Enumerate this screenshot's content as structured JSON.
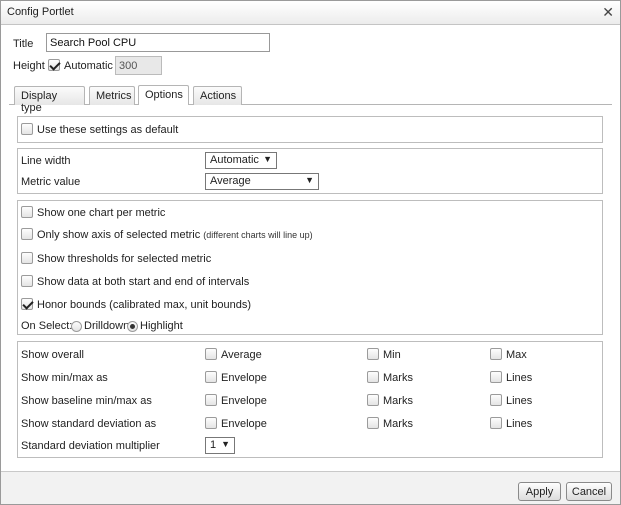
{
  "window": {
    "title": "Config Portlet",
    "close_glyph": "✕"
  },
  "header": {
    "title_label": "Title",
    "title_value": "Search Pool CPU",
    "height_label": "Height",
    "automatic_label": "Automatic",
    "automatic_checked": true,
    "height_value": "300"
  },
  "tabs": [
    {
      "label": "Display type",
      "active": false
    },
    {
      "label": "Metrics",
      "active": false
    },
    {
      "label": "Options",
      "active": true
    },
    {
      "label": "Actions",
      "active": false
    }
  ],
  "defaults_group": {
    "label": "Use these settings as default",
    "checked": false
  },
  "line_group": {
    "line_width_label": "Line width",
    "line_width_value": "Automatic",
    "metric_value_label": "Metric value",
    "metric_value_value": "Average"
  },
  "options_group": {
    "one_chart": {
      "label": "Show one chart per metric",
      "checked": false
    },
    "only_axis": {
      "label": "Only show axis of selected metric",
      "note": "(different charts will line up)",
      "checked": false
    },
    "thresholds": {
      "label": "Show thresholds for selected metric",
      "checked": false
    },
    "both_ends": {
      "label": "Show data at both start and end of intervals",
      "checked": false
    },
    "honor_bounds": {
      "label": "Honor bounds (calibrated max, unit bounds)",
      "checked": true
    },
    "on_select_label": "On Select:",
    "drilldown_label": "Drilldown",
    "highlight_label": "Highlight",
    "on_select_value": "Highlight"
  },
  "stats_group": {
    "rows": [
      {
        "label": "Show overall",
        "opts": [
          "Average",
          "Min",
          "Max"
        ]
      },
      {
        "label": "Show min/max as",
        "opts": [
          "Envelope",
          "Marks",
          "Lines"
        ]
      },
      {
        "label": "Show baseline min/max as",
        "opts": [
          "Envelope",
          "Marks",
          "Lines"
        ]
      },
      {
        "label": "Show standard deviation as",
        "opts": [
          "Envelope",
          "Marks",
          "Lines"
        ]
      }
    ],
    "multiplier_label": "Standard deviation multiplier",
    "multiplier_value": "1"
  },
  "footer": {
    "apply_label": "Apply",
    "cancel_label": "Cancel"
  },
  "icons": {
    "dropdown": "▼"
  }
}
